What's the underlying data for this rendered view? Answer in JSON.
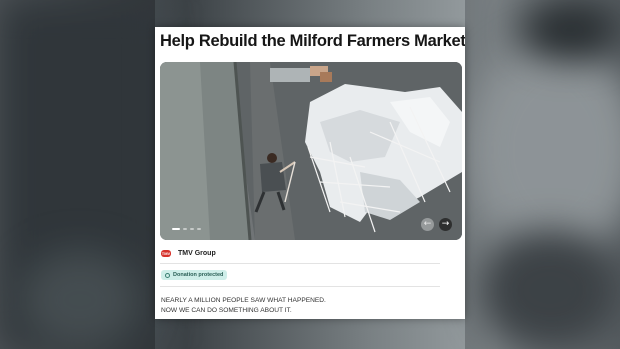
{
  "campaign": {
    "title": "Help Rebuild the Milford Farmers Market",
    "photo_description_icon": "photo-carousel",
    "carousel": {
      "total_slides": 4,
      "active_slide": 1,
      "prev_icon": "arrow-left-icon",
      "next_icon": "arrow-right-icon",
      "prev_glyph": "←",
      "next_glyph": "→"
    },
    "organizer": {
      "logo_text": "TMV",
      "name": "TMV Group"
    },
    "badge": {
      "icon": "shield-check-icon",
      "label": "Donation protected"
    },
    "story_lines": [
      "NEARLY A MILLION PEOPLE SAW WHAT HAPPENED.",
      "NOW WE CAN DO SOMETHING ABOUT IT."
    ]
  },
  "colors": {
    "badge_bg": "#cfeee9",
    "badge_text": "#2b5f56",
    "logo_red": "#d7322b"
  }
}
